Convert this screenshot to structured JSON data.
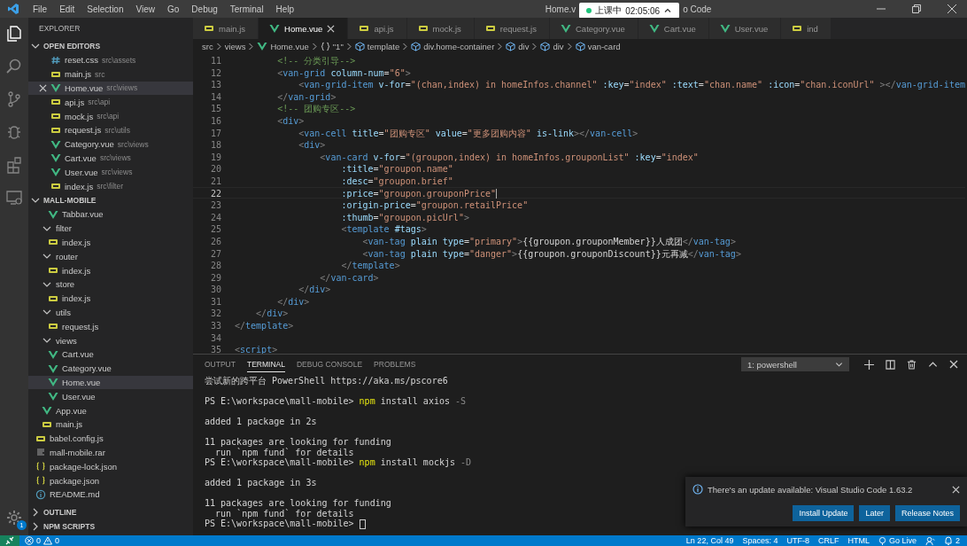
{
  "window": {
    "title_parts": [
      "Home.v",
      "o Code"
    ],
    "menu": [
      "File",
      "Edit",
      "Selection",
      "View",
      "Go",
      "Debug",
      "Terminal",
      "Help"
    ]
  },
  "class_badge": {
    "label": "上课中",
    "time": "02:05:06"
  },
  "activity_bar": {
    "settings_badge": "1"
  },
  "sidebar": {
    "title": "EXPLORER",
    "open_editors": {
      "title": "OPEN EDITORS",
      "expanded": true,
      "items": [
        {
          "name": "reset.css",
          "path": "src\\assets",
          "kind": "css",
          "selected": false
        },
        {
          "name": "main.js",
          "path": "src",
          "kind": "js",
          "selected": false
        },
        {
          "name": "Home.vue",
          "path": "src\\views",
          "kind": "vue",
          "selected": true
        },
        {
          "name": "api.js",
          "path": "src\\api",
          "kind": "js",
          "selected": false
        },
        {
          "name": "mock.js",
          "path": "src\\api",
          "kind": "js",
          "selected": false
        },
        {
          "name": "request.js",
          "path": "src\\utils",
          "kind": "js",
          "selected": false
        },
        {
          "name": "Category.vue",
          "path": "src\\views",
          "kind": "vue",
          "selected": false
        },
        {
          "name": "Cart.vue",
          "path": "src\\views",
          "kind": "vue",
          "selected": false
        },
        {
          "name": "User.vue",
          "path": "src\\views",
          "kind": "vue",
          "selected": false
        },
        {
          "name": "index.js",
          "path": "src\\filter",
          "kind": "js",
          "selected": false
        }
      ]
    },
    "project": {
      "title": "MALL-MOBILE",
      "expanded": true,
      "tree": [
        {
          "children": [
            {
              "children": [
                {
                  "name": "Tabbar.vue",
                  "kind": "vue",
                  "selected": false
                }
              ]
            },
            {
              "name": "filter",
              "kind": "folder",
              "expanded": true,
              "selected": false,
              "children": [
                {
                  "name": "index.js",
                  "kind": "js",
                  "selected": false
                }
              ]
            },
            {
              "name": "router",
              "kind": "folder",
              "expanded": true,
              "selected": false,
              "children": [
                {
                  "name": "index.js",
                  "kind": "js",
                  "selected": false
                }
              ]
            },
            {
              "name": "store",
              "kind": "folder",
              "expanded": true,
              "selected": false,
              "children": [
                {
                  "name": "index.js",
                  "kind": "js",
                  "selected": false
                }
              ]
            },
            {
              "name": "utils",
              "kind": "folder",
              "expanded": true,
              "selected": false,
              "children": [
                {
                  "name": "request.js",
                  "kind": "js",
                  "selected": false
                }
              ]
            },
            {
              "name": "views",
              "kind": "folder",
              "expanded": true,
              "selected": false,
              "children": [
                {
                  "name": "Cart.vue",
                  "kind": "vue",
                  "selected": false
                },
                {
                  "name": "Category.vue",
                  "kind": "vue",
                  "selected": false
                },
                {
                  "name": "Home.vue",
                  "kind": "vue",
                  "selected": true
                },
                {
                  "name": "User.vue",
                  "kind": "vue",
                  "selected": false
                }
              ]
            },
            {
              "name": "App.vue",
              "kind": "vue",
              "selected": false
            },
            {
              "name": "main.js",
              "kind": "js",
              "selected": false
            }
          ]
        },
        {
          "name": "babel.config.js",
          "kind": "js",
          "selected": false
        },
        {
          "name": "mall-mobile.rar",
          "kind": "text",
          "selected": false
        },
        {
          "name": "package-lock.json",
          "kind": "json",
          "selected": false
        },
        {
          "name": "package.json",
          "kind": "json",
          "selected": false
        },
        {
          "name": "README.md",
          "kind": "info",
          "selected": false
        }
      ]
    },
    "bottom_sections": [
      {
        "title": "OUTLINE",
        "expanded": false
      },
      {
        "title": "NPM SCRIPTS",
        "expanded": false
      }
    ]
  },
  "tabs": [
    {
      "label": "main.js",
      "kind": "js",
      "selected": false
    },
    {
      "label": "Home.vue",
      "kind": "vue",
      "selected": true
    },
    {
      "label": "api.js",
      "kind": "js",
      "selected": false
    },
    {
      "label": "mock.js",
      "kind": "js",
      "selected": false
    },
    {
      "label": "request.js",
      "kind": "js",
      "selected": false
    },
    {
      "label": "Category.vue",
      "kind": "vue",
      "selected": false
    },
    {
      "label": "Cart.vue",
      "kind": "vue",
      "selected": false
    },
    {
      "label": "User.vue",
      "kind": "vue",
      "selected": false
    },
    {
      "label": "ind",
      "kind": "js",
      "selected": false
    }
  ],
  "breadcrumb": [
    {
      "label": "src",
      "kind": "plain"
    },
    {
      "label": "views",
      "kind": "plain"
    },
    {
      "label": "Home.vue",
      "kind": "vue"
    },
    {
      "label": "\"1\"",
      "kind": "object"
    },
    {
      "label": "template",
      "kind": "element"
    },
    {
      "label": "div.home-container",
      "kind": "element"
    },
    {
      "label": "div",
      "kind": "element"
    },
    {
      "label": "div",
      "kind": "element"
    },
    {
      "label": "van-card",
      "kind": "element"
    }
  ],
  "code": [
    {
      "no": "11",
      "current": false,
      "tokens": [
        {
          "kind": "comment",
          "text": "        <!-- 分类引导-->"
        }
      ]
    },
    {
      "no": "12",
      "current": false,
      "tokens": [
        {
          "kind": "bracket",
          "text": "        <"
        },
        {
          "kind": "tag",
          "text": "van-grid"
        },
        {
          "kind": "attr",
          "text": " column-num"
        },
        {
          "kind": "plain",
          "text": "="
        },
        {
          "kind": "string",
          "text": "\"6\""
        },
        {
          "kind": "bracket",
          "text": ">"
        }
      ]
    },
    {
      "no": "13",
      "current": false,
      "tokens": [
        {
          "kind": "bracket",
          "text": "            <"
        },
        {
          "kind": "tag",
          "text": "van-grid-item"
        },
        {
          "kind": "attr",
          "text": " v-for"
        },
        {
          "kind": "plain",
          "text": "="
        },
        {
          "kind": "string",
          "text": "\"(chan,index) in homeInfos.channel\""
        },
        {
          "kind": "attr",
          "text": " :key"
        },
        {
          "kind": "plain",
          "text": "="
        },
        {
          "kind": "string",
          "text": "\"index\""
        },
        {
          "kind": "attr",
          "text": " :text"
        },
        {
          "kind": "plain",
          "text": "="
        },
        {
          "kind": "string",
          "text": "\"chan.name\""
        },
        {
          "kind": "attr",
          "text": " :icon"
        },
        {
          "kind": "plain",
          "text": "="
        },
        {
          "kind": "string",
          "text": "\"chan.iconUrl\""
        },
        {
          "kind": "bracket",
          "text": " ></"
        },
        {
          "kind": "tag",
          "text": "van-grid-item"
        }
      ]
    },
    {
      "no": "14",
      "current": false,
      "tokens": [
        {
          "kind": "bracket",
          "text": "        </"
        },
        {
          "kind": "tag",
          "text": "van-grid"
        },
        {
          "kind": "bracket",
          "text": ">"
        }
      ]
    },
    {
      "no": "15",
      "current": false,
      "tokens": [
        {
          "kind": "comment",
          "text": "        <!-- 团购专区-->"
        }
      ]
    },
    {
      "no": "16",
      "current": false,
      "tokens": [
        {
          "kind": "bracket",
          "text": "        <"
        },
        {
          "kind": "tag",
          "text": "div"
        },
        {
          "kind": "bracket",
          "text": ">"
        }
      ]
    },
    {
      "no": "17",
      "current": false,
      "tokens": [
        {
          "kind": "bracket",
          "text": "            <"
        },
        {
          "kind": "tag",
          "text": "van-cell"
        },
        {
          "kind": "attr",
          "text": " title"
        },
        {
          "kind": "plain",
          "text": "="
        },
        {
          "kind": "string",
          "text": "\"团购专区\""
        },
        {
          "kind": "attr",
          "text": " value"
        },
        {
          "kind": "plain",
          "text": "="
        },
        {
          "kind": "string",
          "text": "\"更多团购内容\""
        },
        {
          "kind": "attr",
          "text": " is-link"
        },
        {
          "kind": "bracket",
          "text": "></"
        },
        {
          "kind": "tag",
          "text": "van-cell"
        },
        {
          "kind": "bracket",
          "text": ">"
        }
      ]
    },
    {
      "no": "18",
      "current": false,
      "tokens": [
        {
          "kind": "bracket",
          "text": "            <"
        },
        {
          "kind": "tag",
          "text": "div"
        },
        {
          "kind": "bracket",
          "text": ">"
        }
      ]
    },
    {
      "no": "19",
      "current": false,
      "tokens": [
        {
          "kind": "bracket",
          "text": "                <"
        },
        {
          "kind": "tag",
          "text": "van-card"
        },
        {
          "kind": "attr",
          "text": " v-for"
        },
        {
          "kind": "plain",
          "text": "="
        },
        {
          "kind": "string",
          "text": "\"(groupon,index) in homeInfos.grouponList\""
        },
        {
          "kind": "attr",
          "text": " :key"
        },
        {
          "kind": "plain",
          "text": "="
        },
        {
          "kind": "string",
          "text": "\"index\""
        }
      ]
    },
    {
      "no": "20",
      "current": false,
      "tokens": [
        {
          "kind": "attr",
          "text": "                    :title"
        },
        {
          "kind": "plain",
          "text": "="
        },
        {
          "kind": "string",
          "text": "\"groupon.name\""
        }
      ]
    },
    {
      "no": "21",
      "current": false,
      "tokens": [
        {
          "kind": "attr",
          "text": "                    :desc"
        },
        {
          "kind": "plain",
          "text": "="
        },
        {
          "kind": "string",
          "text": "\"groupon.brief\""
        }
      ]
    },
    {
      "no": "22",
      "current": true,
      "tokens": [
        {
          "kind": "attr",
          "text": "                    :price"
        },
        {
          "kind": "plain",
          "text": "="
        },
        {
          "kind": "string",
          "text": "\"groupon.grouponPrice\""
        }
      ]
    },
    {
      "no": "23",
      "current": false,
      "tokens": [
        {
          "kind": "attr",
          "text": "                    :origin-price"
        },
        {
          "kind": "plain",
          "text": "="
        },
        {
          "kind": "string",
          "text": "\"groupon.retailPrice\""
        }
      ]
    },
    {
      "no": "24",
      "current": false,
      "tokens": [
        {
          "kind": "attr",
          "text": "                    :thumb"
        },
        {
          "kind": "plain",
          "text": "="
        },
        {
          "kind": "string",
          "text": "\"groupon.picUrl\""
        },
        {
          "kind": "bracket",
          "text": ">"
        }
      ]
    },
    {
      "no": "25",
      "current": false,
      "tokens": [
        {
          "kind": "bracket",
          "text": "                    <"
        },
        {
          "kind": "tag",
          "text": "template"
        },
        {
          "kind": "attr",
          "text": " #tags"
        },
        {
          "kind": "bracket",
          "text": ">"
        }
      ]
    },
    {
      "no": "26",
      "current": false,
      "tokens": [
        {
          "kind": "bracket",
          "text": "                        <"
        },
        {
          "kind": "tag",
          "text": "van-tag"
        },
        {
          "kind": "attr",
          "text": " plain type"
        },
        {
          "kind": "plain",
          "text": "="
        },
        {
          "kind": "string",
          "text": "\"primary\""
        },
        {
          "kind": "bracket",
          "text": ">"
        },
        {
          "kind": "plain",
          "text": "{{groupon.grouponMember}}人成团"
        },
        {
          "kind": "bracket",
          "text": "</"
        },
        {
          "kind": "tag",
          "text": "van-tag"
        },
        {
          "kind": "bracket",
          "text": ">"
        }
      ]
    },
    {
      "no": "27",
      "current": false,
      "tokens": [
        {
          "kind": "bracket",
          "text": "                        <"
        },
        {
          "kind": "tag",
          "text": "van-tag"
        },
        {
          "kind": "attr",
          "text": " plain type"
        },
        {
          "kind": "plain",
          "text": "="
        },
        {
          "kind": "string",
          "text": "\"danger\""
        },
        {
          "kind": "bracket",
          "text": ">"
        },
        {
          "kind": "plain",
          "text": "{{groupon.grouponDiscount}}元再减"
        },
        {
          "kind": "bracket",
          "text": "</"
        },
        {
          "kind": "tag",
          "text": "van-tag"
        },
        {
          "kind": "bracket",
          "text": ">"
        }
      ]
    },
    {
      "no": "28",
      "current": false,
      "tokens": [
        {
          "kind": "bracket",
          "text": "                    </"
        },
        {
          "kind": "tag",
          "text": "template"
        },
        {
          "kind": "bracket",
          "text": ">"
        }
      ]
    },
    {
      "no": "29",
      "current": false,
      "tokens": [
        {
          "kind": "bracket",
          "text": "                </"
        },
        {
          "kind": "tag",
          "text": "van-card"
        },
        {
          "kind": "bracket",
          "text": ">"
        }
      ]
    },
    {
      "no": "30",
      "current": false,
      "tokens": [
        {
          "kind": "bracket",
          "text": "            </"
        },
        {
          "kind": "tag",
          "text": "div"
        },
        {
          "kind": "bracket",
          "text": ">"
        }
      ]
    },
    {
      "no": "31",
      "current": false,
      "tokens": [
        {
          "kind": "bracket",
          "text": "        </"
        },
        {
          "kind": "tag",
          "text": "div"
        },
        {
          "kind": "bracket",
          "text": ">"
        }
      ]
    },
    {
      "no": "32",
      "current": false,
      "tokens": [
        {
          "kind": "bracket",
          "text": "    </"
        },
        {
          "kind": "tag",
          "text": "div"
        },
        {
          "kind": "bracket",
          "text": ">"
        }
      ]
    },
    {
      "no": "33",
      "current": false,
      "tokens": [
        {
          "kind": "bracket",
          "text": "</"
        },
        {
          "kind": "tag",
          "text": "template"
        },
        {
          "kind": "bracket",
          "text": ">"
        }
      ]
    },
    {
      "no": "34",
      "current": false
    },
    {
      "no": "35",
      "current": false,
      "tokens": [
        {
          "kind": "bracket",
          "text": "<"
        },
        {
          "kind": "tag",
          "text": "script"
        },
        {
          "kind": "bracket",
          "text": ">"
        }
      ]
    }
  ],
  "panel": {
    "tabs": [
      {
        "label": "OUTPUT",
        "selected": false
      },
      {
        "label": "TERMINAL",
        "selected": true
      },
      {
        "label": "DEBUG CONSOLE",
        "selected": false
      },
      {
        "label": "PROBLEMS",
        "selected": false
      }
    ],
    "terminal_select": "1: powershell",
    "terminal": [
      {
        "cursor": false,
        "tokens": [
          {
            "kind": "plain",
            "text": "尝试新的跨平台 PowerShell https://aka.ms/pscore6"
          }
        ]
      },
      {
        "cursor": false
      },
      {
        "cursor": false,
        "tokens": [
          {
            "kind": "plain",
            "text": "PS E:\\workspace\\mall-mobile>"
          },
          {
            "kind": "command",
            "text": " npm"
          },
          {
            "kind": "plain",
            "text": " install axios"
          },
          {
            "kind": "flag",
            "text": " -S"
          }
        ]
      },
      {
        "cursor": false
      },
      {
        "cursor": false,
        "tokens": [
          {
            "kind": "plain",
            "text": "added 1 package in 2s"
          }
        ]
      },
      {
        "cursor": false
      },
      {
        "cursor": false,
        "tokens": [
          {
            "kind": "plain",
            "text": "11 packages are looking for funding"
          }
        ]
      },
      {
        "cursor": false,
        "tokens": [
          {
            "kind": "plain",
            "text": "  run `npm fund` for details"
          }
        ]
      },
      {
        "cursor": false,
        "tokens": [
          {
            "kind": "plain",
            "text": "PS E:\\workspace\\mall-mobile>"
          },
          {
            "kind": "command",
            "text": " npm"
          },
          {
            "kind": "plain",
            "text": " install mockjs"
          },
          {
            "kind": "flag",
            "text": " -D"
          }
        ]
      },
      {
        "cursor": false
      },
      {
        "cursor": false,
        "tokens": [
          {
            "kind": "plain",
            "text": "added 1 package in 3s"
          }
        ]
      },
      {
        "cursor": false
      },
      {
        "cursor": false,
        "tokens": [
          {
            "kind": "plain",
            "text": "11 packages are looking for funding"
          }
        ]
      },
      {
        "cursor": false,
        "tokens": [
          {
            "kind": "plain",
            "text": "  run `npm fund` for details"
          }
        ]
      },
      {
        "cursor": true,
        "tokens": [
          {
            "kind": "plain",
            "text": "PS E:\\workspace\\mall-mobile>"
          }
        ]
      }
    ]
  },
  "notification": {
    "message": "There's an update available: Visual Studio Code 1.63.2",
    "buttons": [
      "Install Update",
      "Later",
      "Release Notes"
    ]
  },
  "status_bar": {
    "errors": "0",
    "warnings": "0",
    "right": [
      {
        "label": "Ln 22, Col 49",
        "kind": "plain"
      },
      {
        "label": "Spaces: 4",
        "kind": "plain"
      },
      {
        "label": "UTF-8",
        "kind": "plain"
      },
      {
        "label": "CRLF",
        "kind": "plain"
      },
      {
        "label": "HTML",
        "kind": "plain"
      },
      {
        "label": "Go Live",
        "kind": "live"
      }
    ],
    "notifications": "2"
  }
}
